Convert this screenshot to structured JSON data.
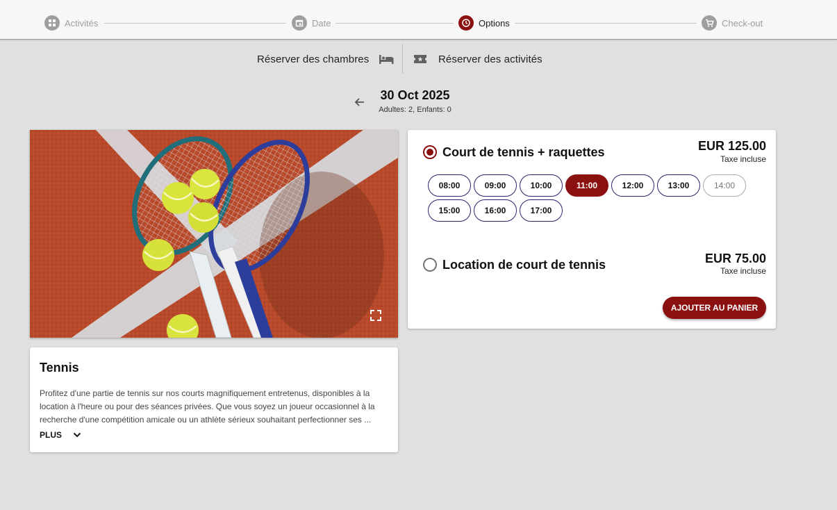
{
  "stepper": {
    "steps": [
      {
        "label": "Activités",
        "icon": "grid-icon",
        "state": "done"
      },
      {
        "label": "Date",
        "icon": "calendar-icon",
        "state": "done"
      },
      {
        "label": "Options",
        "icon": "clock-icon",
        "state": "active"
      },
      {
        "label": "Check-out",
        "icon": "cart-icon",
        "state": "upcoming"
      }
    ]
  },
  "toggle": {
    "rooms_label": "Réserver des chambres",
    "rooms_icon": "bed-icon",
    "activities_label": "Réserver des activités",
    "activities_icon": "ticket-icon"
  },
  "date_header": {
    "date": "30 Oct 2025",
    "guests": "Adultes: 2, Enfants: 0"
  },
  "activity": {
    "title": "Tennis",
    "description_lines": [
      "Profitez d'une partie de tennis sur nos courts magnifiquement entretenus, disponibles à la",
      "location à l'heure ou pour des séances privées. Que vous soyez un joueur occasionnel à la",
      "recherche d'une compétition amicale ou un athlète sérieux souhaitant perfectionner ses ..."
    ],
    "more_label": "PLUS"
  },
  "options": [
    {
      "name": "Court de tennis + raquettes",
      "price": "EUR 125.00",
      "tax": "Taxe incluse",
      "selected": true,
      "slots": [
        {
          "time": "08:00",
          "state": "available"
        },
        {
          "time": "09:00",
          "state": "available"
        },
        {
          "time": "10:00",
          "state": "available"
        },
        {
          "time": "11:00",
          "state": "selected"
        },
        {
          "time": "12:00",
          "state": "available"
        },
        {
          "time": "13:00",
          "state": "available"
        },
        {
          "time": "14:00",
          "state": "disabled"
        },
        {
          "time": "15:00",
          "state": "available"
        },
        {
          "time": "16:00",
          "state": "available"
        },
        {
          "time": "17:00",
          "state": "available"
        }
      ]
    },
    {
      "name": "Location de court de tennis",
      "price": "EUR 75.00",
      "tax": "Taxe incluse",
      "selected": false
    }
  ],
  "add_to_cart_label": "AJOUTER AU PANIER",
  "colors": {
    "accent": "#8b1010",
    "slot_border": "#2e1f6b",
    "background": "#e0e0e0",
    "inactive": "#9e9e9e"
  }
}
